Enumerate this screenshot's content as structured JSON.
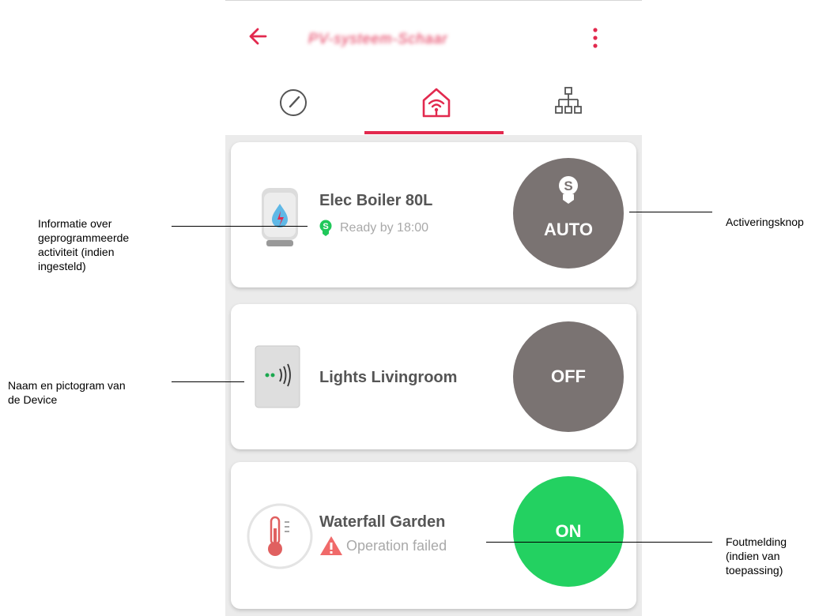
{
  "header": {
    "title_obscured": "PV-systeem-Schaar",
    "back_icon": "arrow-left-icon",
    "menu_icon": "more-vertical-icon"
  },
  "tabs": [
    {
      "name": "dashboard",
      "icon": "gauge-icon"
    },
    {
      "name": "home",
      "icon": "home-wifi-icon",
      "active": true
    },
    {
      "name": "network",
      "icon": "network-tree-icon"
    }
  ],
  "devices": [
    {
      "name": "Elec Boiler 80L",
      "status": "Ready by 18:00",
      "button": "AUTO",
      "icon": "boiler-icon",
      "status_icon": "schedule-bulb-icon"
    },
    {
      "name": "Lights Livingroom",
      "button": "OFF",
      "icon": "smart-plug-icon"
    },
    {
      "name": "Waterfall Garden",
      "status": "Operation failed",
      "button": "ON",
      "icon": "thermometer-icon",
      "status_icon": "warning-triangle-icon"
    }
  ],
  "annotations": {
    "scheduled_info": [
      "Informatie over",
      "geprogrammeerde",
      "activiteit (indien",
      "ingesteld)"
    ],
    "activation_button": "Activeringsknop",
    "device_name_icon": [
      "Naam en pictogram van",
      "de Device"
    ],
    "error_message": [
      "Foutmelding",
      "(indien van",
      "toepassing)"
    ]
  },
  "colors": {
    "accent": "#e2294e",
    "button_grey": "#7a7372",
    "button_green": "#23d161",
    "schedule_green": "#20c85a",
    "warning_red": "#f06a6a"
  }
}
